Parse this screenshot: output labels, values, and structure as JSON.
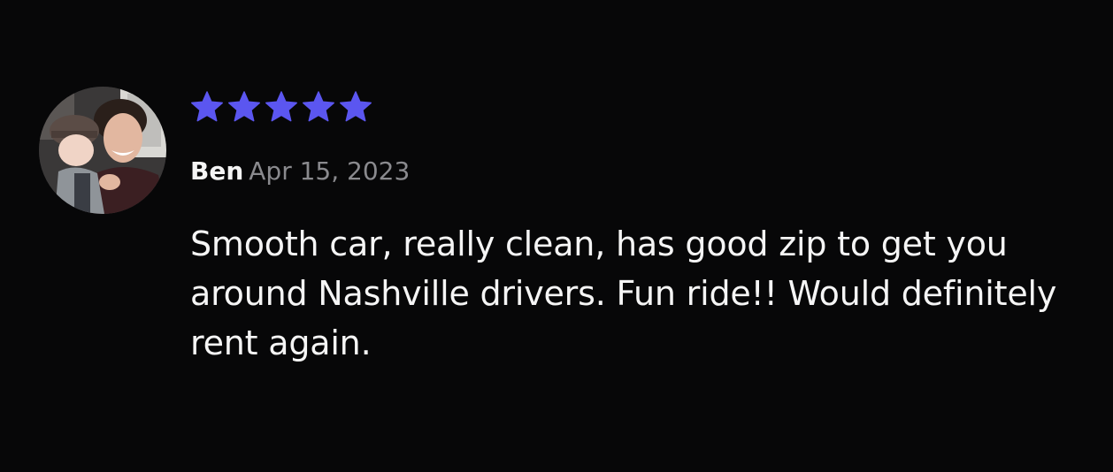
{
  "review": {
    "reviewer": {
      "name": "Ben",
      "avatar_icon": "reviewer-photo-avatar"
    },
    "date": "Apr 15, 2023",
    "rating": 5,
    "rating_max": 5,
    "star_icon": "star-icon",
    "star_color": "#5b56f0",
    "text": "Smooth car, really clean, has good zip to get you around Nashville drivers. Fun ride!! Would definitely rent again."
  }
}
